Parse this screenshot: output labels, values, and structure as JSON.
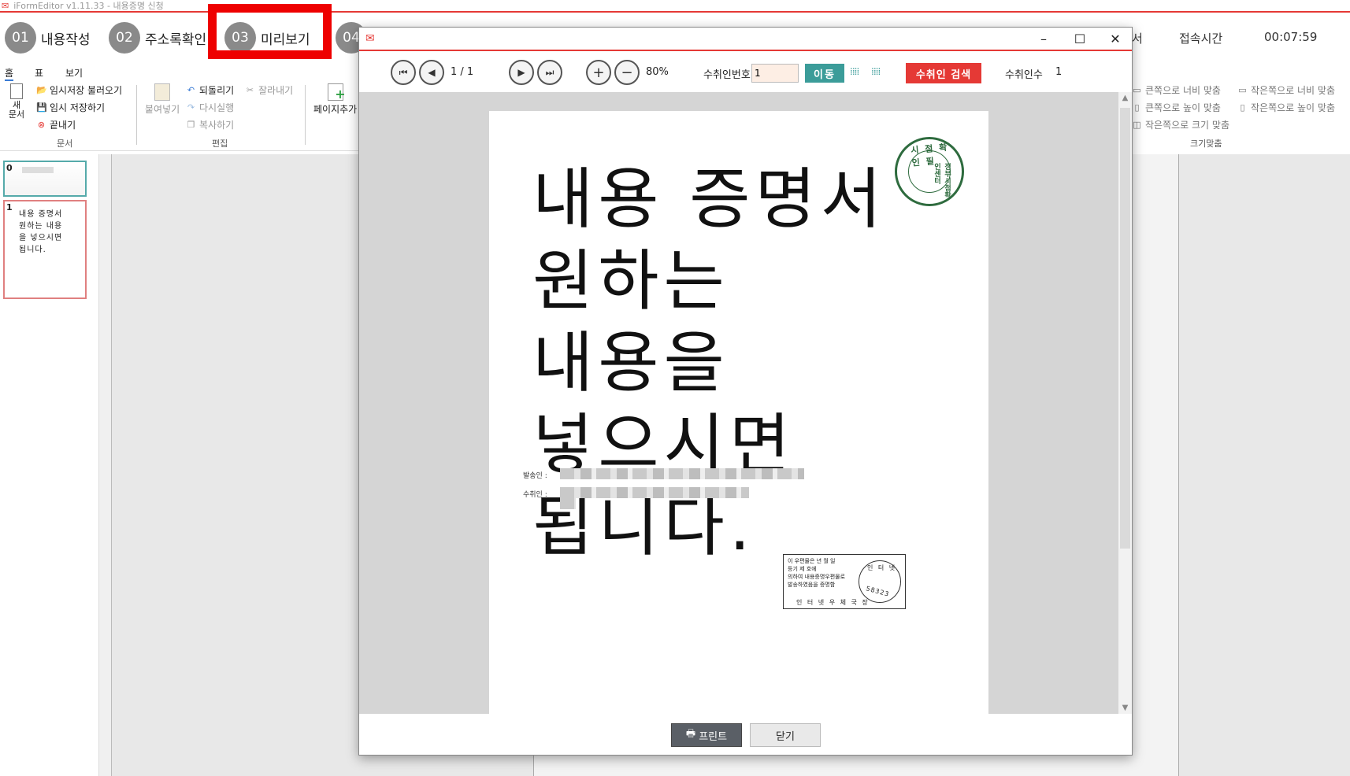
{
  "app": {
    "title": "iFormEditor v1.11.33 - 내용증명 신청"
  },
  "steps": [
    {
      "num": "01",
      "label": "내용작성"
    },
    {
      "num": "02",
      "label": "주소록확인"
    },
    {
      "num": "03",
      "label": "미리보기"
    },
    {
      "num": "04",
      "label": ""
    }
  ],
  "header_right": {
    "partial": "서",
    "session_label": "접속시간",
    "session_time": "00:07:59"
  },
  "ribbon_tabs": [
    "홈",
    "표",
    "보기"
  ],
  "ribbon": {
    "new_doc": "새\n문서",
    "load_temp": "임시저장 불러오기",
    "save_temp": "임시 저장하기",
    "exit": "끝내기",
    "group_doc": "문서",
    "paste": "붙여넣기",
    "undo": "되돌리기",
    "redo": "다시실행",
    "cut": "잘라내기",
    "copy": "복사하기",
    "group_edit": "편집",
    "add_page": "페이지추가",
    "fit_large_width": "큰쪽으로 너비 맞춤",
    "fit_large_height": "큰쪽으로 높이 맞춤",
    "fit_small_size": "작은쪽으로 크기 맞춤",
    "fit_small_width": "작은쪽으로 너비 맞춤",
    "fit_small_height": "작은쪽으로 높이 맞춤",
    "group_fit": "크기맞춤"
  },
  "thumbnails": [
    {
      "num": "0",
      "text": ""
    },
    {
      "num": "1",
      "text": "내용 증명서\n원하는 내용\n을 넣으시면\n됩니다."
    }
  ],
  "dialog": {
    "page_indicator": "1 / 1",
    "zoom": "80%",
    "recipient_no_label": "수취인번호",
    "recipient_no_value": "1",
    "move_button": "이동",
    "search_button": "수취인 검색",
    "recipient_count_label": "수취인수",
    "recipient_count_value": "1",
    "print_button": "프린트",
    "close_button": "닫기"
  },
  "document": {
    "body": "내용 증명서 원하는 내용을 넣으시면 됩니다.",
    "seal_top": "시 점 확 인 필",
    "seal_side": "정부시점확인센터",
    "sender_label": "발송인 :",
    "recipient_label": "수취인 :",
    "postal_line1": "이 우편물은      년   월   일",
    "postal_line2": "등기 제                  호에",
    "postal_line3": "의하여 내용증명우편물로",
    "postal_line4": "발송하였음을 증명함",
    "postal_bottom": "인 터 넷 우 체 국 장",
    "postal_ring_top": "인 터 넷",
    "postal_ring_num": "58323"
  }
}
